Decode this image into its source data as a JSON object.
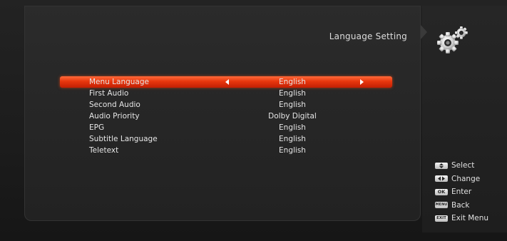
{
  "header": {
    "title": "Language Setting",
    "icon": "gears-icon"
  },
  "menu": {
    "items": [
      {
        "label": "Menu Language",
        "value": "English",
        "selected": true
      },
      {
        "label": "First Audio",
        "value": "English"
      },
      {
        "label": "Second Audio",
        "value": "English"
      },
      {
        "label": "Audio Priority",
        "value": "Dolby Digital"
      },
      {
        "label": "EPG",
        "value": "English"
      },
      {
        "label": "Subtitle Language",
        "value": "English"
      },
      {
        "label": "Teletext",
        "value": "English"
      }
    ]
  },
  "help": {
    "items": [
      {
        "key": "up-down-icon",
        "text": "Select"
      },
      {
        "key": "left-right-icon",
        "text": "Change"
      },
      {
        "key_label": "OK",
        "text": "Enter"
      },
      {
        "key_label": "MENU",
        "text": "Back"
      },
      {
        "key_label": "EXIT",
        "text": "Exit Menu"
      }
    ]
  },
  "colors": {
    "accent": "#e8360d",
    "background": "#1c1c1c"
  }
}
